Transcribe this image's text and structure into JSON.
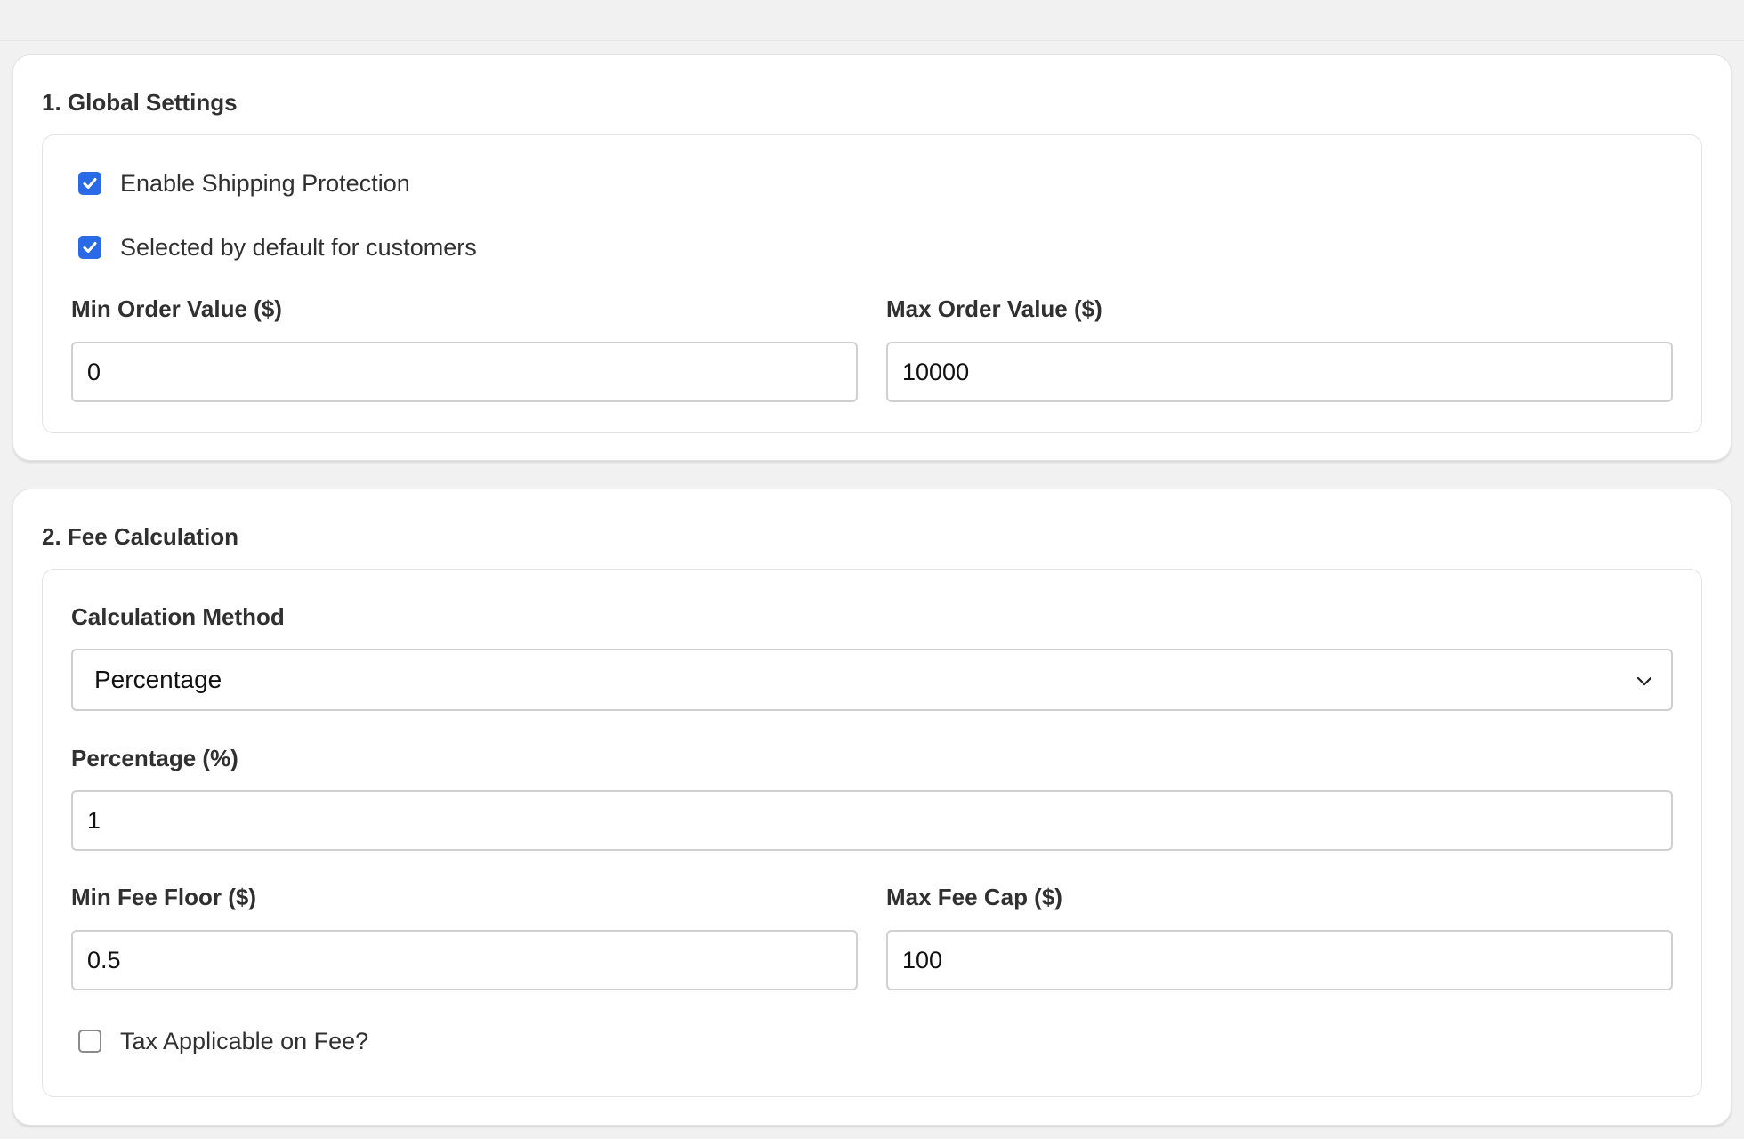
{
  "global_settings": {
    "title": "1. Global Settings",
    "enable_protection": {
      "label": "Enable Shipping Protection",
      "checked": true
    },
    "selected_default": {
      "label": "Selected by default for customers",
      "checked": true
    },
    "min_order": {
      "label": "Min Order Value ($)",
      "value": "0"
    },
    "max_order": {
      "label": "Max Order Value ($)",
      "value": "10000"
    }
  },
  "fee_calculation": {
    "title": "2. Fee Calculation",
    "method": {
      "label": "Calculation Method",
      "value": "Percentage"
    },
    "percentage": {
      "label": "Percentage (%)",
      "value": "1"
    },
    "min_fee": {
      "label": "Min Fee Floor ($)",
      "value": "0.5"
    },
    "max_fee": {
      "label": "Max Fee Cap ($)",
      "value": "100"
    },
    "tax_applicable": {
      "label": "Tax Applicable on Fee?",
      "checked": false
    }
  },
  "colors": {
    "accent": "#2a6ae6",
    "background": "#f1f1f1",
    "card": "#ffffff"
  },
  "icons": {
    "checkbox_checked": "checkmark-icon",
    "select_arrow": "chevron-down-icon"
  }
}
